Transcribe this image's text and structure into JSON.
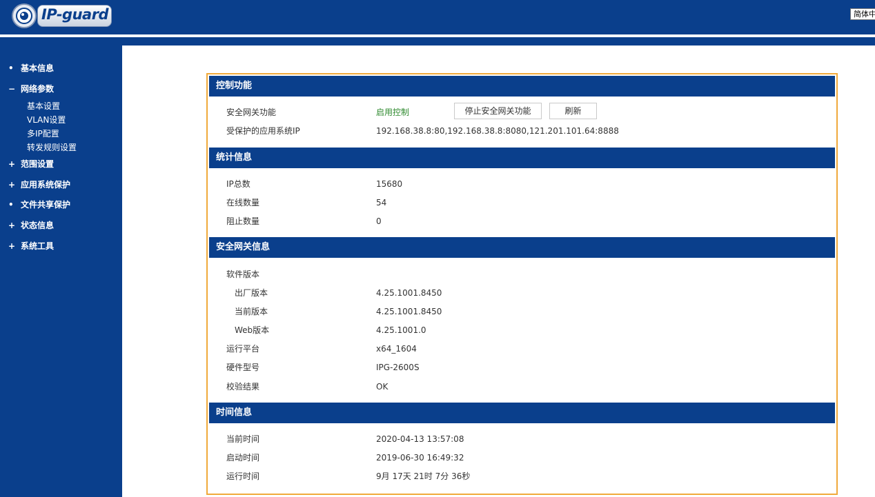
{
  "header": {
    "logo_text": "IP-guard",
    "language": "简体中文"
  },
  "sidebar": {
    "items": [
      {
        "mark": "•",
        "label": "基本信息"
      },
      {
        "mark": "−",
        "label": "网络参数"
      },
      {
        "mark": "+",
        "label": "范围设置"
      },
      {
        "mark": "+",
        "label": "应用系统保护"
      },
      {
        "mark": "•",
        "label": "文件共享保护"
      },
      {
        "mark": "+",
        "label": "状态信息"
      },
      {
        "mark": "+",
        "label": "系统工具"
      }
    ],
    "subitems": [
      "基本设置",
      "VLAN设置",
      "多IP配置",
      "转发规则设置"
    ]
  },
  "control": {
    "title": "控制功能",
    "gateway_label": "安全网关功能",
    "gateway_status": "启用控制",
    "stop_button": "停止安全网关功能",
    "refresh_button": "刷新",
    "protected_label": "受保护的应用系统IP",
    "protected_value": "192.168.38.8:80,192.168.38.8:8080,121.201.101.64:8888"
  },
  "stats": {
    "title": "统计信息",
    "rows": [
      {
        "label": "IP总数",
        "value": "15680"
      },
      {
        "label": "在线数量",
        "value": "54"
      },
      {
        "label": "阻止数量",
        "value": "0"
      }
    ]
  },
  "gateway": {
    "title": "安全网关信息",
    "software_version": "软件版本",
    "rows": [
      {
        "label": "出厂版本",
        "value": "4.25.1001.8450"
      },
      {
        "label": "当前版本",
        "value": "4.25.1001.8450"
      },
      {
        "label": "Web版本",
        "value": "4.25.1001.0"
      },
      {
        "label": "运行平台",
        "value": "x64_1604"
      },
      {
        "label": "硬件型号",
        "value": "IPG-2600S"
      },
      {
        "label": "校验结果",
        "value": "OK"
      }
    ]
  },
  "time": {
    "title": "时间信息",
    "rows": [
      {
        "label": "当前时间",
        "value": "2020-04-13 13:57:08"
      },
      {
        "label": "启动时间",
        "value": "2019-06-30 16:49:32"
      },
      {
        "label": "运行时间",
        "value": "9月 17天 21时 7分 36秒"
      }
    ]
  },
  "colors": {
    "brand_blue": "#0a3f8c",
    "panel_border": "#f0a93a",
    "status_green": "#2f8a2f"
  }
}
